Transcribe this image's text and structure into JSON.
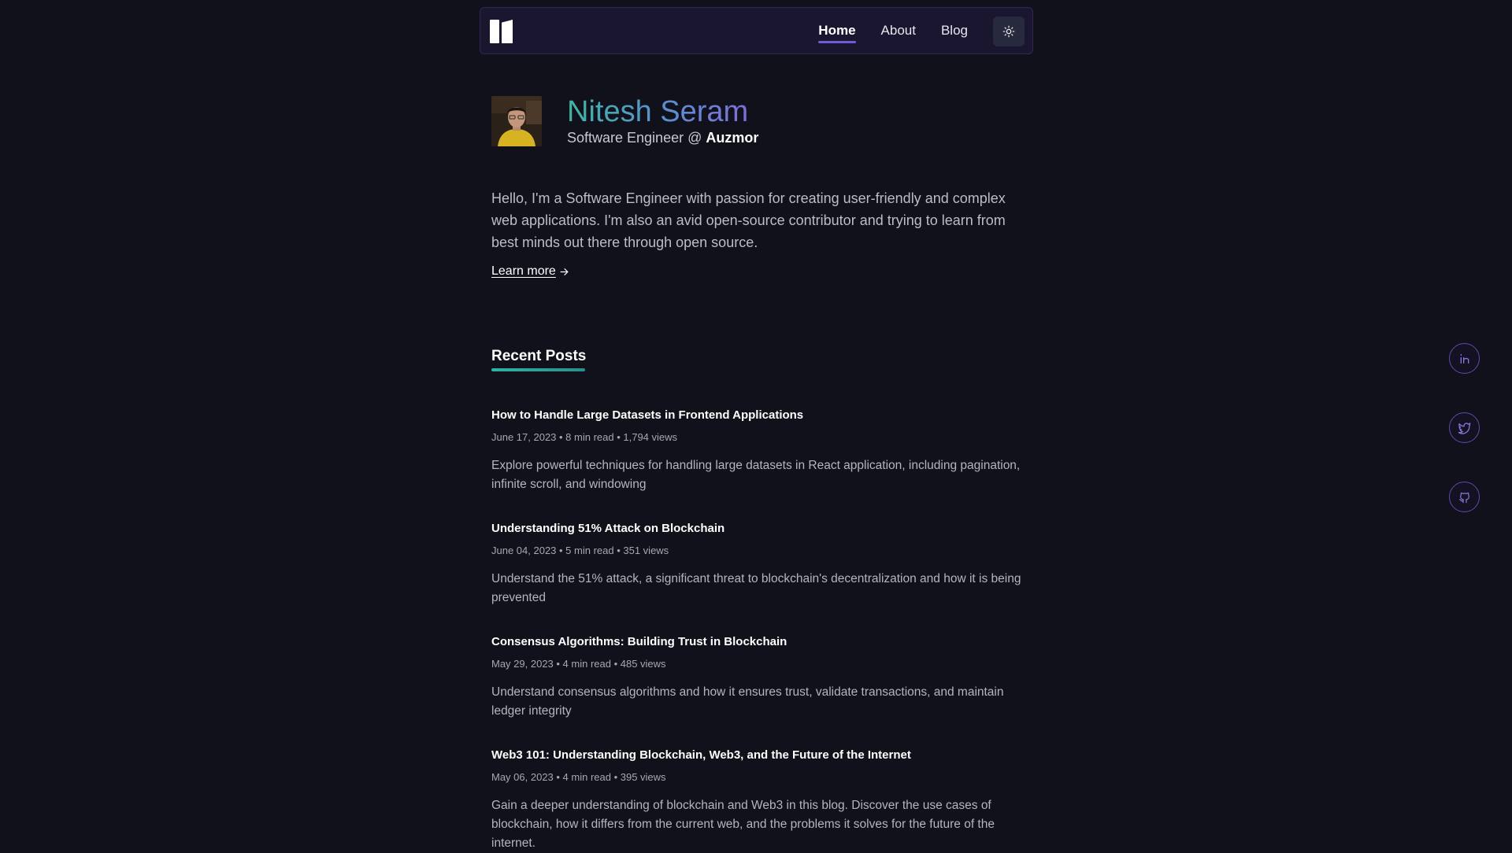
{
  "nav": {
    "links": [
      "Home",
      "About",
      "Blog"
    ]
  },
  "hero": {
    "name": "Nitesh Seram",
    "role": "Software Engineer @ ",
    "company": "Auzmor",
    "intro": "Hello, I'm a Software Engineer with passion for creating user-friendly and complex web applications. I'm also an avid open-source contributor and trying to learn from best minds out there through open source.",
    "learn_more": "Learn more"
  },
  "recent_posts": {
    "title": "Recent Posts",
    "posts": [
      {
        "title": "How to Handle Large Datasets in Frontend Applications",
        "meta": "June 17, 2023 • 8 min read • 1,794 views",
        "desc": "Explore powerful techniques for handling large datasets in React application, including pagination, infinite scroll, and windowing"
      },
      {
        "title": "Understanding 51% Attack on Blockchain",
        "meta": "June 04, 2023 • 5 min read • 351 views",
        "desc": "Understand the 51% attack, a significant threat to blockchain's decentralization and how it is being prevented"
      },
      {
        "title": "Consensus Algorithms: Building Trust in Blockchain",
        "meta": "May 29, 2023 • 4 min read • 485 views",
        "desc": "Understand consensus algorithms and how it ensures trust, validate transactions, and maintain ledger integrity"
      },
      {
        "title": "Web3 101: Understanding Blockchain, Web3, and the Future of the Internet",
        "meta": "May 06, 2023 • 4 min read • 395 views",
        "desc": "Gain a deeper understanding of blockchain and Web3 in this blog. Discover the use cases of blockchain, how it differs from the current web, and the problems it solves for the future of the internet."
      }
    ]
  },
  "social": {
    "icons": [
      "linkedin-icon",
      "twitter-icon",
      "github-icon"
    ]
  },
  "colors": {
    "background": "#11111c",
    "nav_bg": "#1a1630",
    "accent_purple": "#6f5bd6",
    "accent_teal": "#2fb3a0"
  }
}
